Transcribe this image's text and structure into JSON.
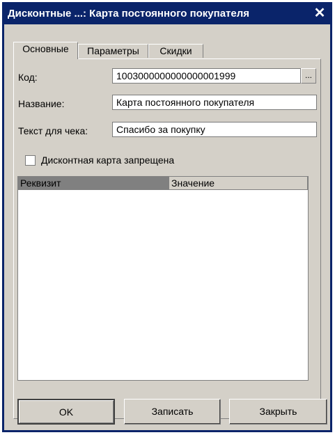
{
  "window": {
    "title": "Дисконтные ...: Карта постоянного покупателя",
    "close_glyph": "✕"
  },
  "tabs": [
    {
      "label": "Основные",
      "active": true
    },
    {
      "label": "Параметры",
      "active": false
    },
    {
      "label": "Скидки",
      "active": false
    }
  ],
  "form": {
    "code_label": "Код:",
    "code_value": "1003000000000000001999",
    "code_button": "...",
    "name_label": "Название:",
    "name_value": "Карта постоянного покупателя",
    "receipt_label": "Текст для чека:",
    "receipt_value": "Спасибо за покупку",
    "forbidden_label": "Дисконтная карта запрещена",
    "forbidden_checked": false
  },
  "grid": {
    "columns": [
      "Реквизит",
      "Значение"
    ],
    "rows": []
  },
  "buttons": {
    "ok": "OK",
    "save": "Записать",
    "close": "Закрыть"
  }
}
